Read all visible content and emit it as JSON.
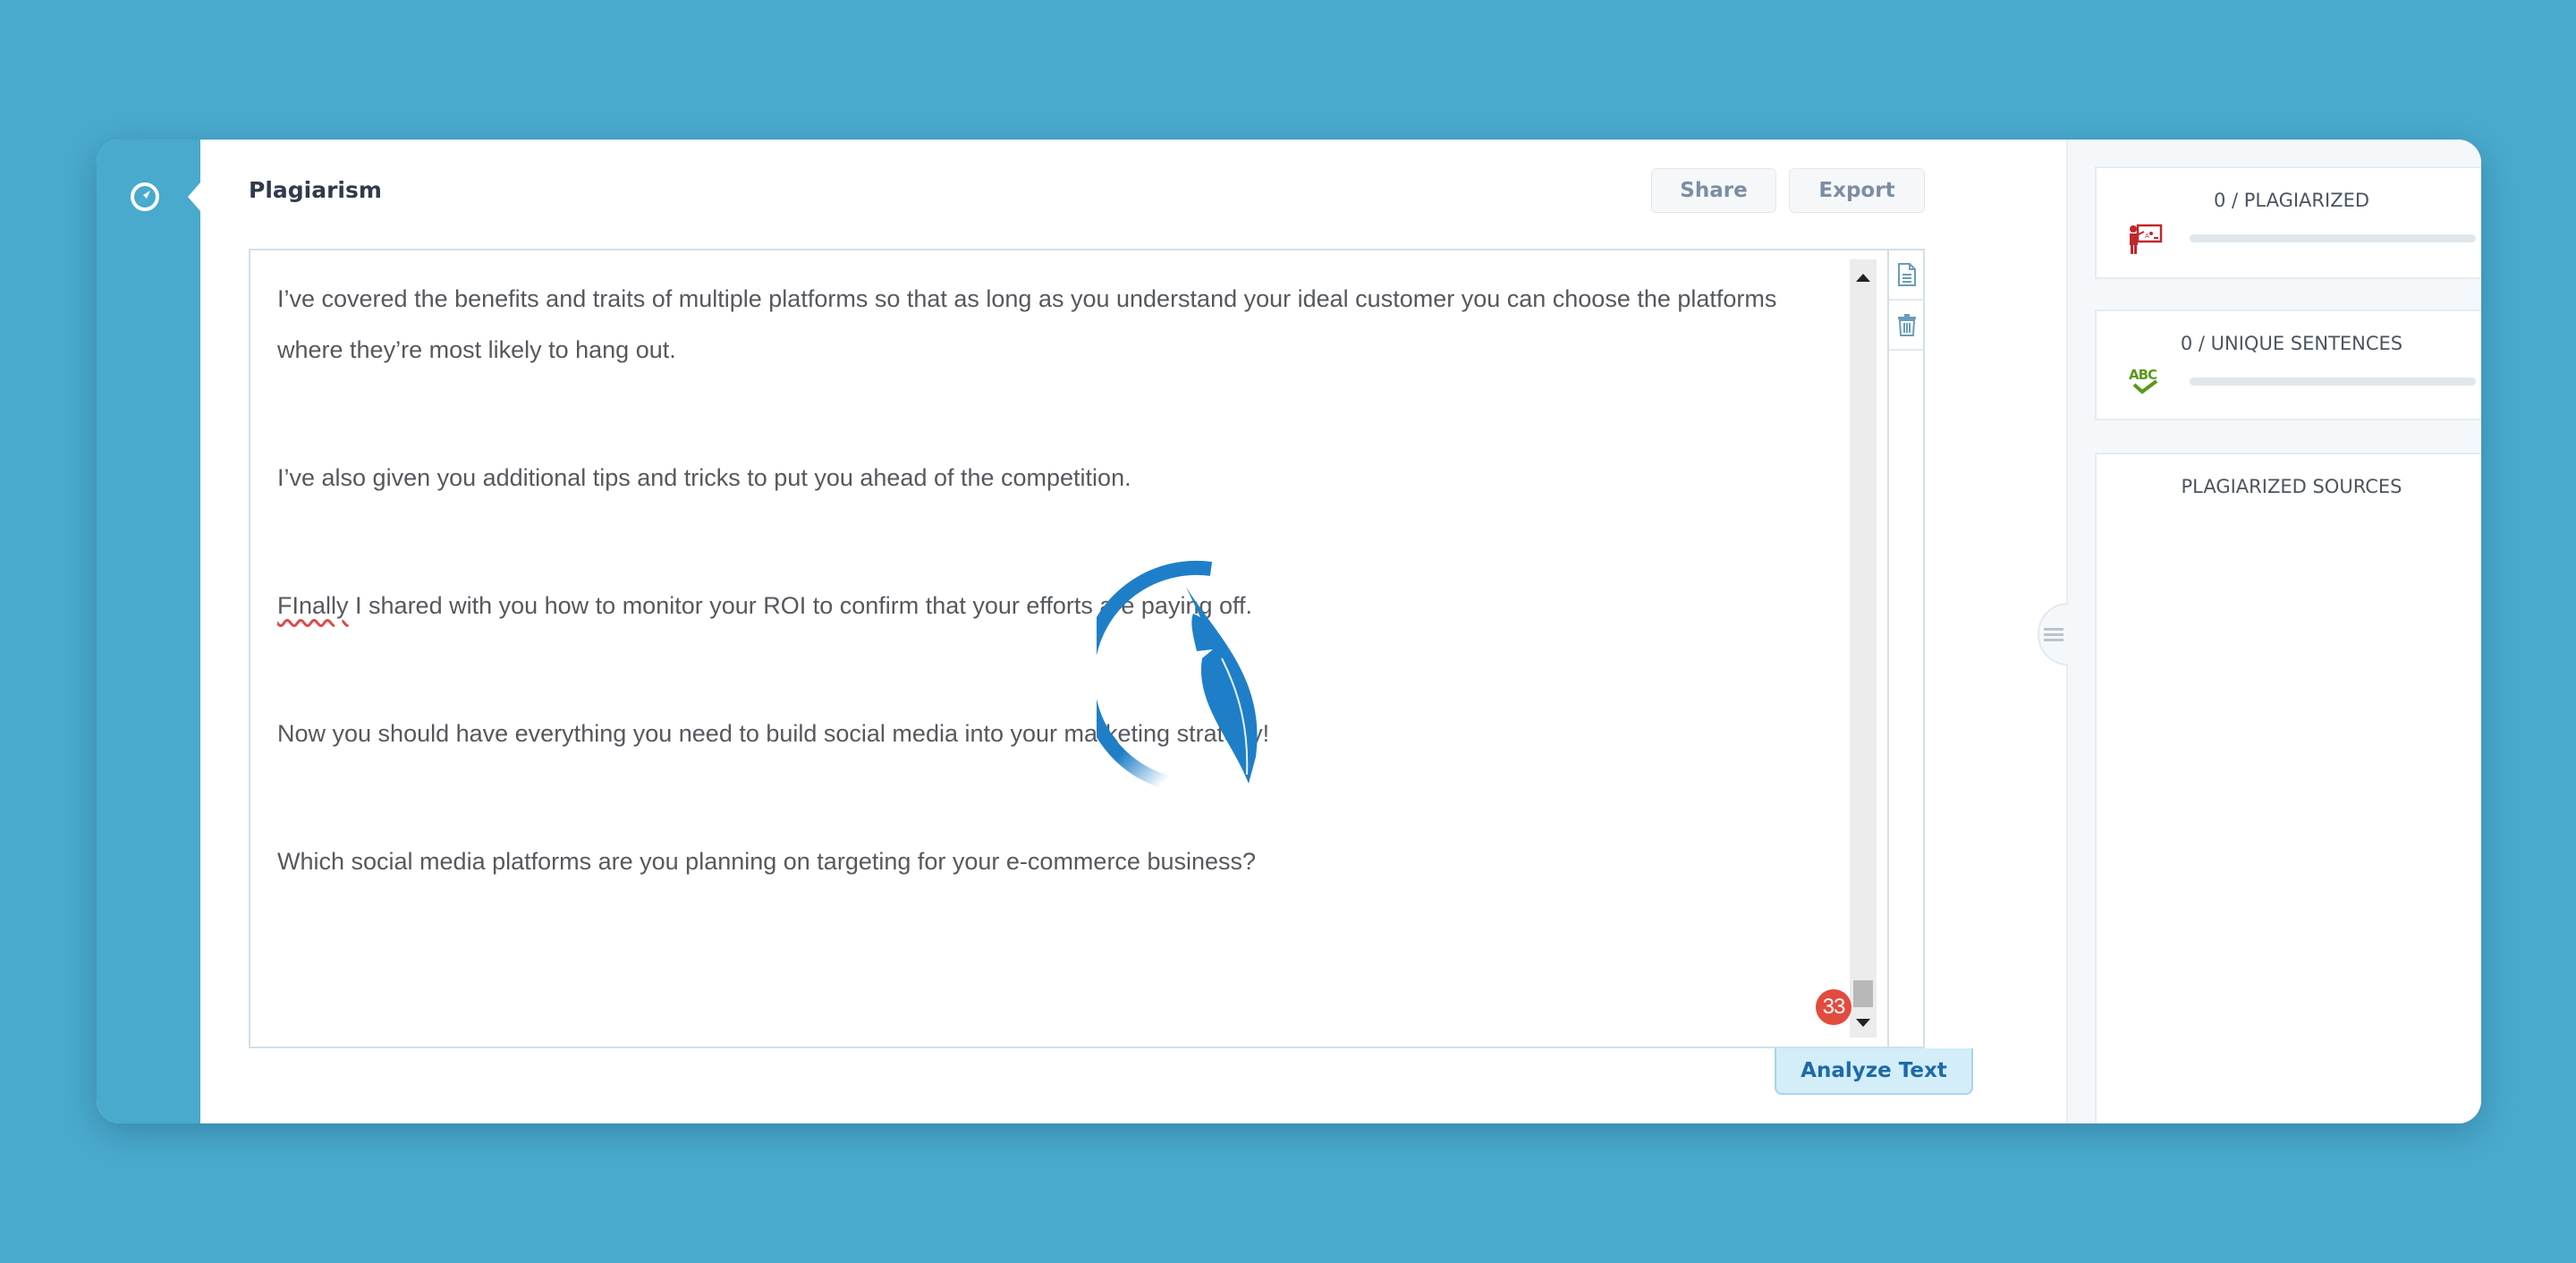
{
  "nav": {
    "icon": "compass-icon"
  },
  "header": {
    "title": "Plagiarism",
    "share_label": "Share",
    "export_label": "Export"
  },
  "editor": {
    "paragraphs": [
      "I’ve covered the benefits and traits of multiple platforms so that as long as you understand your ideal customer you can choose the platforms where they’re most likely to hang out.",
      "I’ve also given you additional tips and tricks to put you ahead of the competition.",
      {
        "misspelled": "FInally",
        "rest": " I shared with you how to monitor your ROI to confirm that your efforts are paying off."
      },
      "Now you should have everything you need to build social media into your marketing strategy!",
      "Which social media platforms are you planning on targeting for your e-commerce business?"
    ],
    "issue_count": "33",
    "tools": [
      "document-icon",
      "trash-icon"
    ],
    "analyze_label": "Analyze Text",
    "loading": true
  },
  "results": {
    "plagiarized": {
      "label": "0 / PLAGIARIZED",
      "progress": 0,
      "icon": "teacher-board-icon",
      "icon_color": "#c0272d"
    },
    "unique": {
      "label": "0 / UNIQUE SENTENCES",
      "progress": 0,
      "icon": "abc-check-icon",
      "icon_color": "#5a9a1a"
    },
    "sources": {
      "label": "PLAGIARIZED SOURCES"
    }
  },
  "colors": {
    "background": "#4aabcf",
    "rail": "#49aacd",
    "accent": "#1e7fc8",
    "badge": "#e34b3f"
  }
}
